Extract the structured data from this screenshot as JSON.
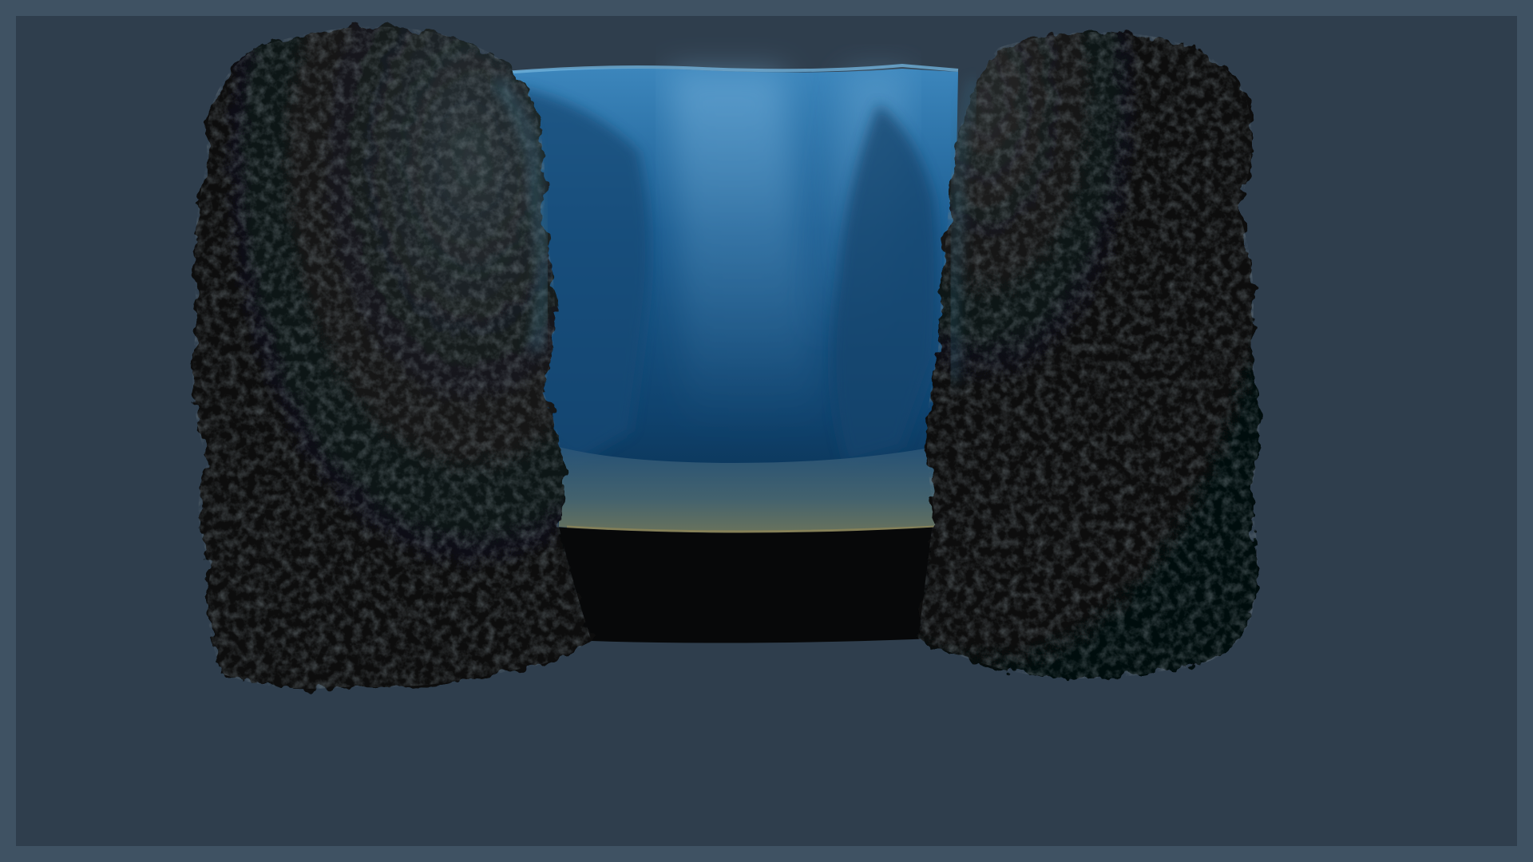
{
  "scene": {
    "subject": "",
    "colors": {
      "outer_frame": "#3f5263",
      "background": "#2f3e4d",
      "rock": "#0b0c0d",
      "rock_highlight": "#1d2a30",
      "water_deep": "#0e3f6a",
      "water_light": "#3b83b8",
      "water_surface": "#5fa3cf",
      "sand": "#6e7a6a"
    }
  }
}
